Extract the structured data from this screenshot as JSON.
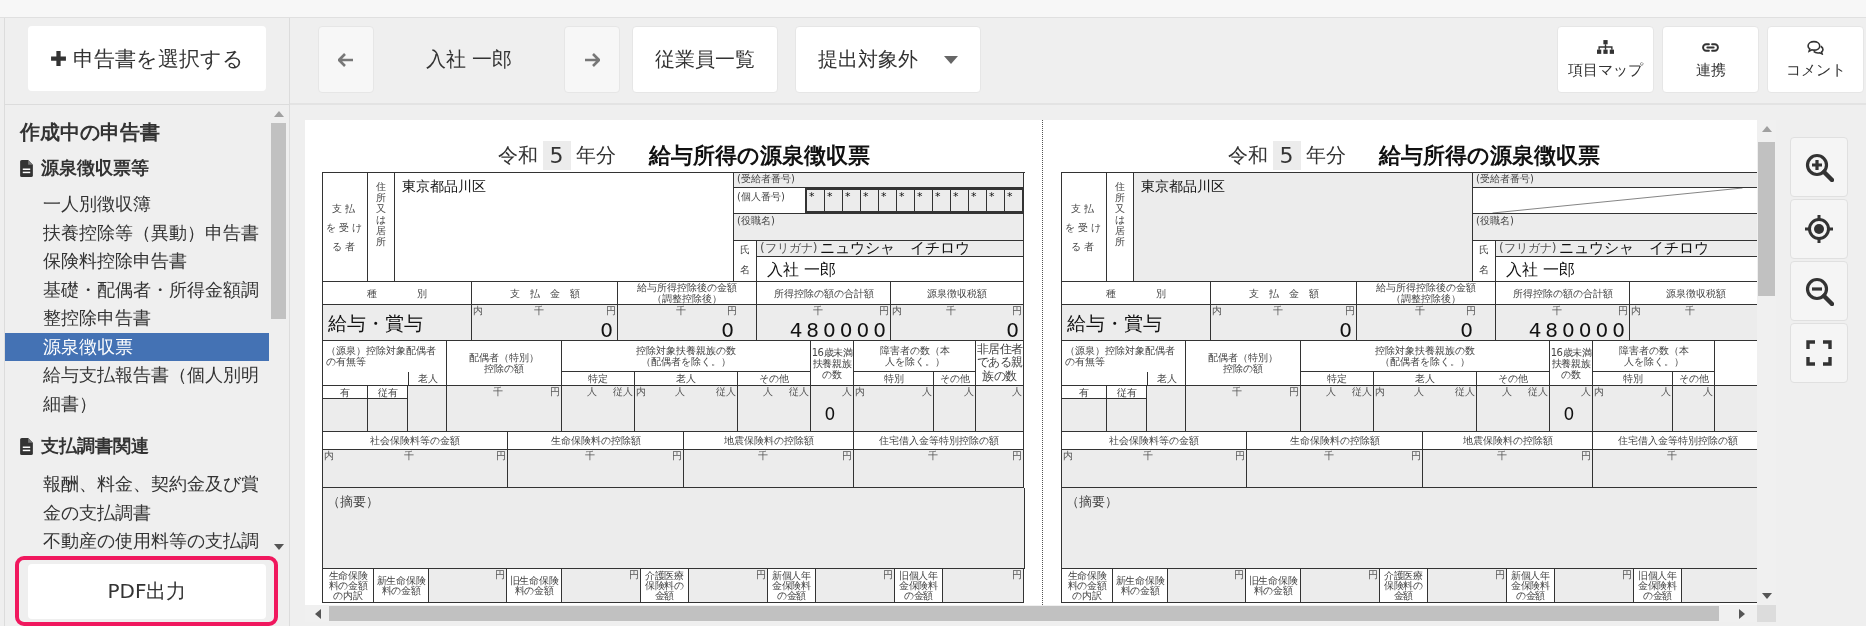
{
  "sidebar": {
    "add_button": "申告書を選択する",
    "heading": "作成中の申告書",
    "sections": [
      {
        "title": "源泉徴収票等",
        "items": [
          {
            "label": "一人別徴収簿",
            "selected": false
          },
          {
            "label": "扶養控除等（異動）申告書",
            "selected": false
          },
          {
            "label": "保険料控除申告書",
            "selected": false
          },
          {
            "label": "基礎・配偶者・所得金額調整控除申告書",
            "selected": false
          },
          {
            "label": "源泉徴収票",
            "selected": true
          },
          {
            "label": "給与支払報告書（個人別明細書）",
            "selected": false
          }
        ]
      },
      {
        "title": "支払調書関連",
        "items": [
          {
            "label": "報酬、料金、契約金及び賞金の支払調書",
            "selected": false
          },
          {
            "label": "不動産の使用料等の支払調",
            "selected": false
          }
        ]
      }
    ],
    "pdf_button": "PDF出力"
  },
  "toolbar": {
    "employee": "入社 一郎",
    "employee_list": "従業員一覧",
    "status": "提出対象外",
    "tools": [
      "項目マップ",
      "連携",
      "コメント"
    ]
  },
  "forms": [
    {
      "era": "令和",
      "year": "5",
      "year_suffix": "年分",
      "title": "給与所得の源泉徴収票",
      "recipient_label": [
        "支払",
        "を受け",
        "る者"
      ],
      "address_label": "住所又は居所",
      "address": "東京都品川区",
      "recipient_no_label": "(受給者番号)",
      "personal_number": {
        "kind": "masked",
        "label": "(個人番号)",
        "digits": [
          "*",
          "*",
          "*",
          "*",
          "*",
          "*",
          "*",
          "*",
          "*",
          "*",
          "*",
          "*"
        ]
      },
      "position_label": "(役職名)",
      "name_labels": [
        "氏",
        "名"
      ],
      "furigana_label": "(フリガナ)",
      "furigana": "ニュウシャ　イチロウ",
      "name": "入社 一郎",
      "kind_headers": [
        "種　　　　別",
        "支　払　金　額",
        "給与所得控除後の金額（調整控除後）",
        "所得控除の額の合計額",
        "源泉徴収税額"
      ],
      "kind": "給与・賞与",
      "amounts": [
        {
          "inner": "内",
          "units": [
            "千",
            "円"
          ],
          "value": "0"
        },
        {
          "units": [
            "千",
            "円"
          ],
          "value": "0"
        },
        {
          "units": [
            "千",
            "円"
          ],
          "value": "480000"
        },
        {
          "inner": "内",
          "units": [
            "千",
            "円"
          ],
          "value": "0"
        }
      ],
      "deductions": {
        "spouse_header": "（源泉）控除対象配偶者の有無等",
        "senior_header": "老人",
        "presence": [
          "有",
          "従有"
        ],
        "spouse_amount_header": "配偶者（特別）控除の額",
        "spouse_amount": {
          "units": [
            "千",
            "円"
          ]
        },
        "dependents_header": "控除対象扶養親族の数（配偶者を除く。）",
        "dependent_types": [
          "特定",
          "老人",
          "その他"
        ],
        "dependents": [
          {
            "units": [
              "人",
              "従人"
            ]
          },
          {
            "inner": "内",
            "units": [
              "人",
              "従人"
            ]
          },
          {
            "units": [
              "人",
              "従人"
            ]
          }
        ],
        "under16_header": "16歳未満扶養親族の数",
        "under16": {
          "units": [
            "人"
          ],
          "value": "0"
        },
        "disabled_header": "障害者の数（本人を除く。）",
        "disabled_types": [
          "特別",
          "その他"
        ],
        "disabled": [
          {
            "inner": "内",
            "units": [
              "人"
            ]
          },
          {
            "units": [
              "人"
            ]
          }
        ],
        "nonresident_header": "非居住者である親族の数",
        "nonresident": {
          "units": [
            "人"
          ]
        }
      },
      "insurance_headers": [
        "社会保険料等の金額",
        "生命保険料の控除額",
        "地震保険料の控除額",
        "住宅借入金等特別控除の額"
      ],
      "insurance": [
        {
          "inner": "内",
          "units": [
            "千",
            "円"
          ]
        },
        {
          "units": [
            "千",
            "円"
          ]
        },
        {
          "units": [
            "千",
            "円"
          ]
        },
        {
          "units": [
            "千",
            "円"
          ]
        }
      ],
      "remarks_label": "（摘要）",
      "breakdown_title": "生命保険料の金額の内訳",
      "breakdown": [
        {
          "label": "新生命保険料の金額",
          "unit": "円"
        },
        {
          "label": "旧生命保険料の金額",
          "unit": "円"
        },
        {
          "label": "介護医療保険料の金額",
          "unit": "円"
        },
        {
          "label": "新個人年金保険料の金額",
          "unit": "円"
        },
        {
          "label": "旧個人年金保険料の金額",
          "unit": "円"
        }
      ]
    },
    {
      "era": "令和",
      "year": "5",
      "year_suffix": "年分",
      "title": "給与所得の源泉徴収票",
      "recipient_label": [
        "支払",
        "を受け",
        "る者"
      ],
      "address_label": "住所又は居所",
      "address": "東京都品川区",
      "recipient_no_label": "(受給者番号)",
      "personal_number": {
        "kind": "blank"
      },
      "position_label": "(役職名)",
      "name_labels": [
        "氏",
        "名"
      ],
      "furigana_label": "(フリガナ)",
      "furigana": "ニュウシャ　イチロウ",
      "name": "入社 一郎",
      "kind_headers": [
        "種　　　　別",
        "支　払　金　額",
        "給与所得控除後の金額（調整控除後）",
        "所得控除の額の合計額",
        "源泉徴収税額"
      ],
      "kind": "給与・賞与",
      "amounts": [
        {
          "inner": "内",
          "units": [
            "千",
            "円"
          ],
          "value": "0"
        },
        {
          "units": [
            "千",
            "円"
          ],
          "value": "0"
        },
        {
          "units": [
            "千",
            "円"
          ],
          "value": "480000"
        },
        {
          "inner": "内",
          "units": [
            "千"
          ]
        }
      ],
      "deductions": {
        "spouse_header": "（源泉）控除対象配偶者の有無等",
        "senior_header": "老人",
        "presence": [
          "有",
          "従有"
        ],
        "spouse_amount_header": "配偶者（特別）控除の額",
        "spouse_amount": {
          "units": [
            "千",
            "円"
          ]
        },
        "dependents_header": "控除対象扶養親族の数（配偶者を除く。）",
        "dependent_types": [
          "特定",
          "老人",
          "その他"
        ],
        "dependents": [
          {
            "units": [
              "人",
              "従人"
            ]
          },
          {
            "inner": "内",
            "units": [
              "人",
              "従人"
            ]
          },
          {
            "units": [
              "人",
              "従人"
            ]
          }
        ],
        "under16_header": "16歳未満扶養親族の数",
        "under16": {
          "units": [
            "人"
          ],
          "value": "0"
        },
        "disabled_header": "障害者の数（本人を除く。）",
        "disabled_types": [
          "特別",
          "その他"
        ],
        "disabled": [
          {
            "inner": "内",
            "units": [
              "人"
            ]
          },
          {
            "units": [
              "人"
            ]
          }
        ]
      },
      "insurance_headers": [
        "社会保険料等の金額",
        "生命保険料の控除額",
        "地震保険料の控除額",
        "住宅借入金等特別控除の額"
      ],
      "insurance": [
        {
          "inner": "内",
          "units": [
            "千",
            "円"
          ]
        },
        {
          "units": [
            "千",
            "円"
          ]
        },
        {
          "units": [
            "千",
            "円"
          ]
        },
        {
          "units": [
            "千"
          ]
        }
      ],
      "remarks_label": "（摘要）",
      "breakdown_title": "生命保険料の金額の内訳",
      "breakdown": [
        {
          "label": "新生命保険料の金額",
          "unit": "円"
        },
        {
          "label": "旧生命保険料の金額",
          "unit": "円"
        },
        {
          "label": "介護医療保険料の金額",
          "unit": "円"
        },
        {
          "label": "新個人年金保険料の金額",
          "unit": "円"
        },
        {
          "label": "旧個人年金保険料の金額"
        }
      ]
    }
  ]
}
